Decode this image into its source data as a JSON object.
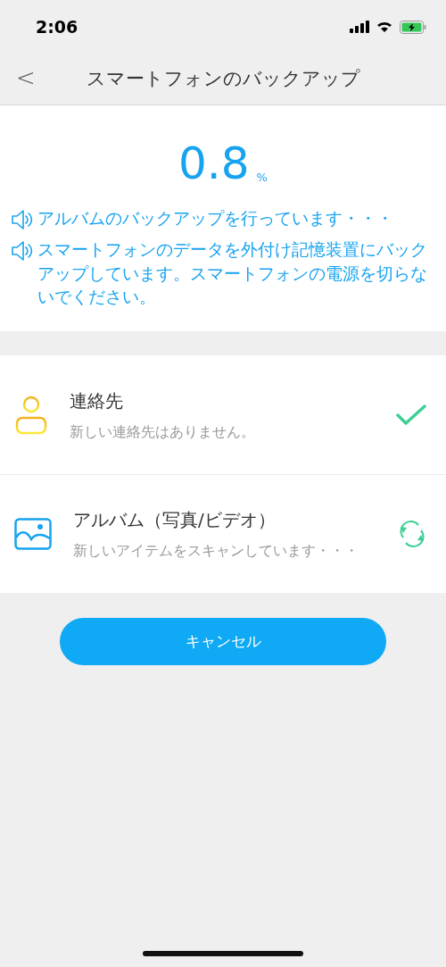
{
  "status_bar": {
    "time": "2:06"
  },
  "nav": {
    "back": "<",
    "title": "スマートフォンのバックアップ"
  },
  "progress": {
    "value": "0.8",
    "unit": "%"
  },
  "messages": [
    "アルバムのバックアップを行っています・・・",
    "スマートフォンのデータを外付け記憶装置にバックアップしています。スマートフォンの電源を切らないでください。"
  ],
  "items": [
    {
      "kind": "contacts",
      "title": "連絡先",
      "subtitle": "新しい連絡先はありません。",
      "completed": true
    },
    {
      "kind": "album",
      "title": "アルバム（写真/ビデオ）",
      "subtitle": "新しいアイテムをスキャンしています・・・",
      "completed": false
    }
  ],
  "cancel_button": "キャンセル"
}
